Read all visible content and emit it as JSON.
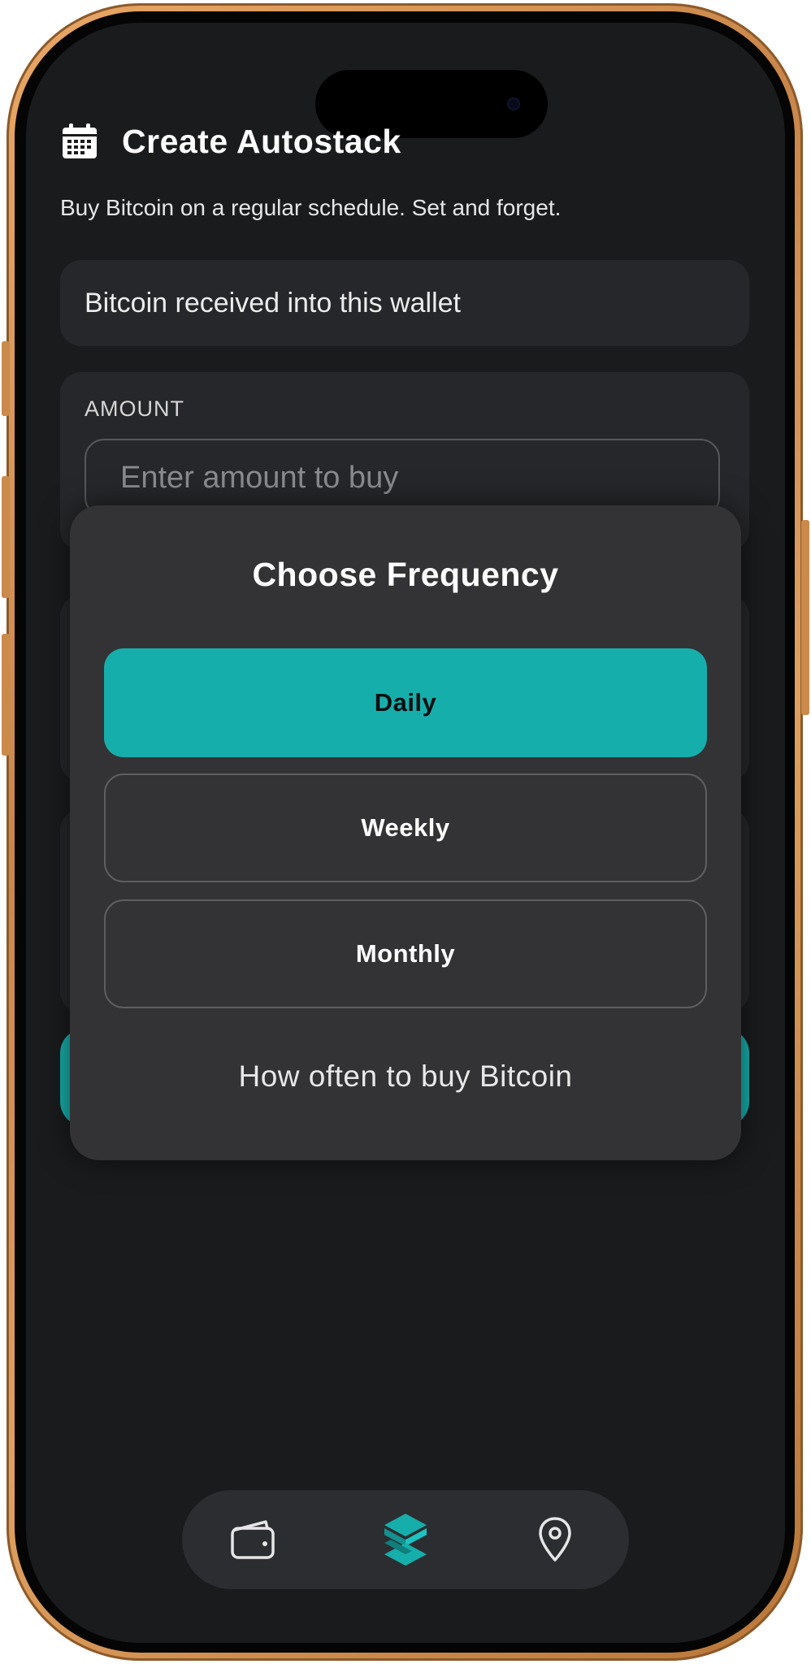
{
  "header": {
    "title": "Create Autostack",
    "icon": "calendar-icon",
    "subtitle": "Buy Bitcoin on a regular schedule. Set and forget."
  },
  "wallet_card": {
    "text": "Bitcoin received into this wallet"
  },
  "amount": {
    "label": "AMOUNT",
    "value": "",
    "placeholder": "Enter amount to buy"
  },
  "frequency_modal": {
    "title": "Choose Frequency",
    "options": [
      {
        "label": "Daily",
        "selected": true
      },
      {
        "label": "Weekly",
        "selected": false
      },
      {
        "label": "Monthly",
        "selected": false
      }
    ],
    "hint": "How often to buy Bitcoin"
  },
  "tab_bar": {
    "items": [
      {
        "icon": "wallet-icon"
      },
      {
        "icon": "stack-logo-icon",
        "active": true
      },
      {
        "icon": "location-pin-icon"
      }
    ]
  },
  "colors": {
    "accent": "#16aeab",
    "background": "#1a1b1d",
    "card": "#26272a",
    "modal": "#333335",
    "frame": "#d9985a"
  }
}
